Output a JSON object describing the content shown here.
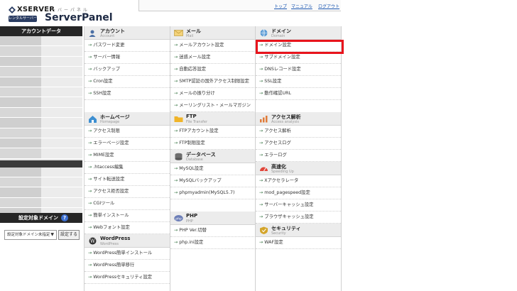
{
  "header": {
    "brand": "XSERVER",
    "rental_label": "レンタルサーバー",
    "kana": "サーバーパネル",
    "product": "ServerPanel",
    "links": [
      "トップ",
      "マニュアル",
      "ログアウト"
    ]
  },
  "sidebar": {
    "account_data_title": "アカウントデータ",
    "target_domain_title": "設定対象ドメイン",
    "help_label": "?",
    "domain_select_value": "設定対象ドメイン未指定",
    "domain_select_arrow": "▼",
    "set_button": "設定する"
  },
  "columns": [
    [
      {
        "title": "アカウント",
        "sub": "Account",
        "items": [
          "パスワード変更",
          "サーバー情報",
          "バックアップ",
          "Cron設定",
          "SSH設定"
        ],
        "blank": 1
      },
      {
        "title": "ホームページ",
        "sub": "Homepage",
        "items": [
          "アクセス制限",
          "エラーページ設定",
          "MIME設定",
          ".htaccess編集",
          "サイト転送設定",
          "アクセス拒否設定",
          "CGIツール",
          "簡単インストール",
          "Webフォント設定"
        ],
        "blank": 0
      },
      {
        "title": "WordPress",
        "sub": "WordPress",
        "items": [
          "WordPress簡単インストール",
          "WordPress簡単移行",
          "WordPressセキュリティ設定"
        ],
        "blank": 0
      }
    ],
    [
      {
        "title": "メール",
        "sub": "Mail",
        "items": [
          "メールアカウント設定",
          "迷惑メール設定",
          "自動応答設定",
          "SMTP認証の国外アクセス制限設定",
          "メールの振り分け",
          "メーリングリスト・メールマガジン"
        ],
        "blank": 0
      },
      {
        "title": "FTP",
        "sub": "File Transfer",
        "items": [
          "FTPアカウント設定",
          "FTP制限設定"
        ],
        "blank": 0
      },
      {
        "title": "データベース",
        "sub": "Database",
        "items": [
          "MySQL設定",
          "MySQLバックアップ",
          "phpmyadmin(MySQL5.7)"
        ],
        "blank": 1
      },
      {
        "title": "PHP",
        "sub": "PHP",
        "items": [
          "PHP Ver.切替",
          "php.ini設定"
        ],
        "blank": 0
      }
    ],
    [
      {
        "title": "ドメイン",
        "sub": "Domain",
        "items": [
          "ドメイン設定",
          "サブドメイン設定",
          "DNSレコード設定",
          "SSL設定",
          "動作確認URL"
        ],
        "blank": 1
      },
      {
        "title": "アクセス解析",
        "sub": "Access analysis",
        "items": [
          "アクセス解析",
          "アクセスログ",
          "エラーログ"
        ],
        "blank": 0
      },
      {
        "title": "高速化",
        "sub": "Speeding Up",
        "items": [
          "Xアクセラレータ",
          "mod_pagespeed設定",
          "サーバーキャッシュ設定",
          "ブラウザキャッシュ設定"
        ],
        "blank": 0
      },
      {
        "title": "セキュリティ",
        "sub": "Security",
        "items": [
          "WAF設定"
        ],
        "blank": 0
      }
    ]
  ],
  "icons": {
    "columns": [
      [
        "user-icon",
        "home-icon",
        "wordpress-icon"
      ],
      [
        "envelope-icon",
        "folder-icon",
        "database-icon",
        "php-icon"
      ],
      [
        "globe-icon",
        "chart-icon",
        "speed-icon",
        "shield-icon"
      ]
    ]
  },
  "colors": {
    "highlight": "#e8141c",
    "sidebar_header": "#262626",
    "link": "#1a56b0",
    "arrow": "#2e6f3c"
  }
}
